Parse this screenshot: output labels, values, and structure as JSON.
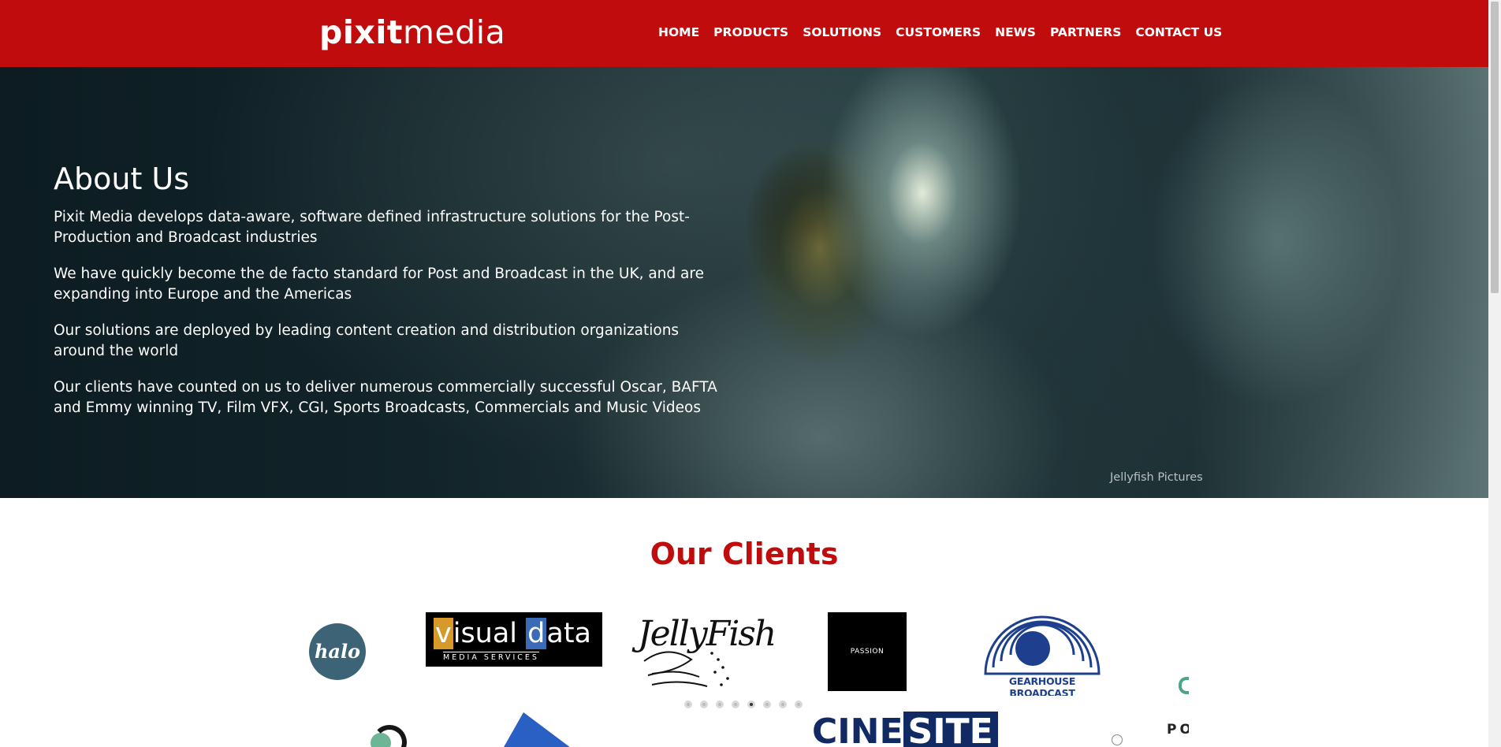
{
  "header": {
    "logo_bold": "pixit",
    "logo_light": "media",
    "nav": [
      "HOME",
      "PRODUCTS",
      "SOLUTIONS",
      "CUSTOMERS",
      "NEWS",
      "PARTNERS",
      "CONTACT US"
    ]
  },
  "hero": {
    "title": "About Us",
    "paragraphs": [
      "Pixit Media develops data-aware, software defined infrastructure solutions for the Post-Production and Broadcast industries",
      "We have quickly become the de facto standard for Post and Broadcast in the UK, and are expanding into Europe and the Americas",
      "Our solutions are deployed by leading content creation and distribution organizations around the world",
      "Our clients have counted on us to deliver numerous commercially successful Oscar, BAFTA and Emmy winning TV, Film VFX, CGI, Sports Broadcasts, Commercials and Music Videos"
    ],
    "caption": "Jellyfish Pictures"
  },
  "clients": {
    "title": "Our Clients",
    "logos": {
      "halo": "halo",
      "visual_data_a": "v",
      "visual_data_b": "isual ",
      "visual_data_c": "d",
      "visual_data_d": "ata",
      "visual_data_sub": "MEDIA SERVICES",
      "jellyfish": "JellyFish",
      "passion": "PASSION",
      "gearhouse": "GEARHOUSE BROADCAST",
      "cinesite_a": "CINE",
      "cinesite_b": "SITE",
      "po": "PO"
    },
    "carousel_dot_count": 8,
    "carousel_active_index": 4
  },
  "colors": {
    "brand_red": "#c00c0c",
    "white": "#ffffff"
  }
}
